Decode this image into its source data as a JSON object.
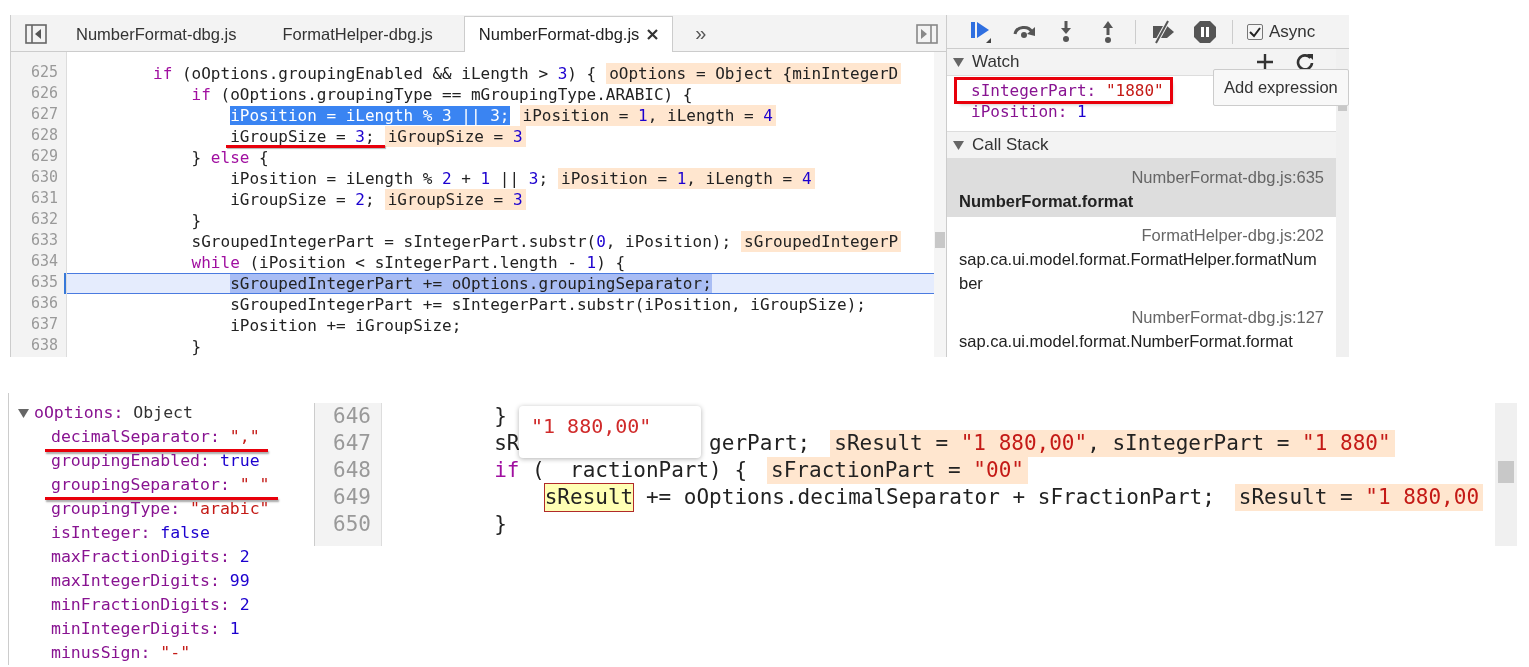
{
  "editor": {
    "tabs": [
      {
        "label": "NumberFormat-dbg.js",
        "selected": false,
        "closable": false
      },
      {
        "label": "FormatHelper-dbg.js",
        "selected": false,
        "closable": false
      },
      {
        "label": "NumberFormat-dbg.js",
        "selected": true,
        "closable": true
      }
    ],
    "more_tabs": "»",
    "lines": [
      {
        "number": "625",
        "tokens": [
          {
            "kind": "keyword",
            "text": "        if"
          },
          {
            "kind": "plain",
            "text": " (oOptions.groupingEnabled && iLength > "
          },
          {
            "kind": "number",
            "text": "3"
          },
          {
            "kind": "plain",
            "text": ") {"
          }
        ],
        "values": [
          {
            "kind": "plain",
            "text": "oOptions = Object {minIntegerD"
          }
        ],
        "selected": false,
        "current": false,
        "underlined": false
      },
      {
        "number": "626",
        "tokens": [
          {
            "kind": "keyword",
            "text": "            if"
          },
          {
            "kind": "plain",
            "text": " (oOptions.groupingType == mGroupingType.ARABIC) {"
          }
        ],
        "selected": false,
        "current": false,
        "underlined": false
      },
      {
        "number": "627",
        "tokens": [
          {
            "kind": "plain",
            "text": "                iPosition = iLength % "
          },
          {
            "kind": "number",
            "text": "3"
          },
          {
            "kind": "plain",
            "text": " || "
          },
          {
            "kind": "number",
            "text": "3"
          },
          {
            "kind": "plain",
            "text": ";"
          }
        ],
        "values": [
          {
            "kind": "plain",
            "text": "iPosition = "
          },
          {
            "kind": "number",
            "text": "1"
          },
          {
            "kind": "plain",
            "text": ", iLength = "
          },
          {
            "kind": "number",
            "text": "4"
          }
        ],
        "selected": true,
        "current": false,
        "underlined": false
      },
      {
        "number": "628",
        "tokens": [
          {
            "kind": "plain",
            "text": "                iGroupSize = "
          },
          {
            "kind": "number",
            "text": "3"
          },
          {
            "kind": "plain",
            "text": ";"
          }
        ],
        "values": [
          {
            "kind": "plain",
            "text": "iGroupSize = "
          },
          {
            "kind": "number",
            "text": "3"
          }
        ],
        "selected": false,
        "current": false,
        "underlined": true
      },
      {
        "number": "629",
        "tokens": [
          {
            "kind": "plain",
            "text": "            } "
          },
          {
            "kind": "keyword",
            "text": "else"
          },
          {
            "kind": "plain",
            "text": " {"
          }
        ],
        "selected": false,
        "current": false,
        "underlined": false
      },
      {
        "number": "630",
        "tokens": [
          {
            "kind": "plain",
            "text": "                iPosition = iLength % "
          },
          {
            "kind": "number",
            "text": "2"
          },
          {
            "kind": "plain",
            "text": " + "
          },
          {
            "kind": "number",
            "text": "1"
          },
          {
            "kind": "plain",
            "text": " || "
          },
          {
            "kind": "number",
            "text": "3"
          },
          {
            "kind": "plain",
            "text": ";"
          }
        ],
        "values": [
          {
            "kind": "plain",
            "text": "iPosition = "
          },
          {
            "kind": "number",
            "text": "1"
          },
          {
            "kind": "plain",
            "text": ", iLength = "
          },
          {
            "kind": "number",
            "text": "4"
          }
        ],
        "selected": false,
        "current": false,
        "underlined": false
      },
      {
        "number": "631",
        "tokens": [
          {
            "kind": "plain",
            "text": "                iGroupSize = "
          },
          {
            "kind": "number",
            "text": "2"
          },
          {
            "kind": "plain",
            "text": ";"
          }
        ],
        "values": [
          {
            "kind": "plain",
            "text": "iGroupSize = "
          },
          {
            "kind": "number",
            "text": "3"
          }
        ],
        "selected": false,
        "current": false,
        "underlined": false
      },
      {
        "number": "632",
        "tokens": [
          {
            "kind": "plain",
            "text": "            }"
          }
        ],
        "selected": false,
        "current": false,
        "underlined": false
      },
      {
        "number": "633",
        "tokens": [
          {
            "kind": "plain",
            "text": "            sGroupedIntegerPart = sIntegerPart.substr("
          },
          {
            "kind": "number",
            "text": "0"
          },
          {
            "kind": "plain",
            "text": ", iPosition);"
          }
        ],
        "values": [
          {
            "kind": "plain",
            "text": "sGroupedIntegerP"
          }
        ],
        "selected": false,
        "current": false,
        "underlined": false
      },
      {
        "number": "634",
        "tokens": [
          {
            "kind": "keyword",
            "text": "            while"
          },
          {
            "kind": "plain",
            "text": " (iPosition < sIntegerPart.length - "
          },
          {
            "kind": "number",
            "text": "1"
          },
          {
            "kind": "plain",
            "text": ") {"
          }
        ],
        "selected": false,
        "current": false,
        "underlined": false
      },
      {
        "number": "635",
        "tokens": [
          {
            "kind": "plain",
            "text": "                sGroupedIntegerPart += oOptions.groupingSeparator;"
          }
        ],
        "selected": true,
        "current": true,
        "underlined": false
      },
      {
        "number": "636",
        "tokens": [
          {
            "kind": "plain",
            "text": "                sGroupedIntegerPart += sIntegerPart.substr(iPosition, iGroupSize);"
          }
        ],
        "selected": false,
        "current": false,
        "underlined": false
      },
      {
        "number": "637",
        "tokens": [
          {
            "kind": "plain",
            "text": "                iPosition += iGroupSize;"
          }
        ],
        "selected": false,
        "current": false,
        "underlined": false
      },
      {
        "number": "638",
        "tokens": [
          {
            "kind": "plain",
            "text": "            }"
          }
        ],
        "selected": false,
        "current": false,
        "underlined": false
      }
    ]
  },
  "debugger": {
    "async": {
      "label": "Async",
      "checked": true
    },
    "watch": {
      "title": "Watch",
      "expanded": true,
      "items": [
        {
          "name": "sIntegerPart:",
          "value": "\"1880\"",
          "kind": "string",
          "boxed": true
        },
        {
          "name": "iPosition:",
          "value": "1",
          "kind": "number",
          "boxed": false
        }
      ],
      "tooltip": "Add expression"
    },
    "call_stack": {
      "title": "Call Stack",
      "expanded": true,
      "frames": [
        {
          "location": "NumberFormat-dbg.js:635",
          "function": "NumberFormat.format",
          "selected": true
        },
        {
          "location": "FormatHelper-dbg.js:202",
          "function": "sap.ca.ui.model.format.FormatHelper.formatNumber",
          "selected": false
        },
        {
          "location": "NumberFormat-dbg.js:127",
          "function": "sap.ca.ui.model.format.NumberFormat.format",
          "selected": false
        }
      ]
    }
  },
  "object_tree": {
    "name": "oOptions:",
    "type": "Object",
    "expanded": true,
    "properties": [
      {
        "key": "decimalSeparator:",
        "value": "\",\"",
        "kind": "string",
        "underlined": true
      },
      {
        "key": "groupingEnabled:",
        "value": "true",
        "kind": "boolean",
        "underlined": false
      },
      {
        "key": "groupingSeparator:",
        "value": "\" \"",
        "kind": "string",
        "underlined": true
      },
      {
        "key": "groupingType:",
        "value": "\"arabic\"",
        "kind": "string",
        "underlined": false
      },
      {
        "key": "isInteger:",
        "value": "false",
        "kind": "boolean",
        "underlined": false
      },
      {
        "key": "maxFractionDigits:",
        "value": "2",
        "kind": "number",
        "underlined": false
      },
      {
        "key": "maxIntegerDigits:",
        "value": "99",
        "kind": "number",
        "underlined": false
      },
      {
        "key": "minFractionDigits:",
        "value": "2",
        "kind": "number",
        "underlined": false
      },
      {
        "key": "minIntegerDigits:",
        "value": "1",
        "kind": "number",
        "underlined": false
      },
      {
        "key": "minusSign:",
        "value": "\"-\"",
        "kind": "string",
        "underlined": false
      }
    ]
  },
  "console_code": {
    "tooltip": "\"1 880,00\"",
    "lines": [
      {
        "number": "646",
        "before": [
          {
            "kind": "plain",
            "text": "        }"
          }
        ]
      },
      {
        "number": "647",
        "before": [
          {
            "kind": "plain",
            "text": "        sR"
          }
        ],
        "after": [
          {
            "kind": "plain",
            "text": "gerPart;"
          }
        ],
        "values": [
          {
            "kind": "plain",
            "text": "sResult = "
          },
          {
            "kind": "string",
            "text": "\"1 880,00\""
          },
          {
            "kind": "plain",
            "text": ", sIntegerPart = "
          },
          {
            "kind": "string",
            "text": "\"1 880\""
          }
        ]
      },
      {
        "number": "648",
        "before": [
          {
            "kind": "keyword",
            "text": "        if"
          },
          {
            "kind": "plain",
            "text": " ("
          }
        ],
        "after": [
          {
            "kind": "plain",
            "text": "ractionPart) {"
          }
        ],
        "values": [
          {
            "kind": "plain",
            "text": "sFractionPart = "
          },
          {
            "kind": "string",
            "text": "\"00\""
          }
        ]
      },
      {
        "number": "649",
        "before": [
          {
            "kind": "hovered",
            "text": "            sResult"
          },
          {
            "kind": "plain",
            "text": " += oOptions.decimalSeparator + sFractionPart;"
          }
        ],
        "values": [
          {
            "kind": "plain",
            "text": "sResult = "
          },
          {
            "kind": "string",
            "text": "\"1 880,00"
          }
        ]
      },
      {
        "number": "650",
        "before": [
          {
            "kind": "plain",
            "text": "        }"
          }
        ]
      }
    ]
  }
}
